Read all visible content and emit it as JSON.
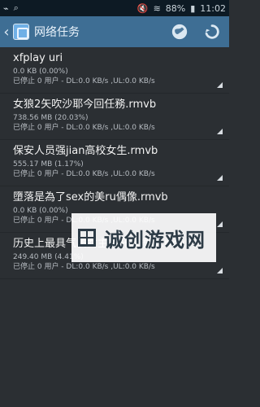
{
  "status_bar": {
    "left_icons": [
      "usb-icon",
      "search-icon"
    ],
    "right_icons": [
      "mute-icon",
      "wifi-icon",
      "battery-icon"
    ],
    "battery": "88%",
    "time": "11:02"
  },
  "app_bar": {
    "title": "网络任务",
    "actions": [
      "globe-icon",
      "refresh-icon"
    ]
  },
  "tasks": [
    {
      "name": "xfplay uri",
      "size": "0.0 KB (0.00%)",
      "status": "已停止 0 用户 - DL:0.0 KB/s ,UL:0.0 KB/s"
    },
    {
      "name": "女狼2矢吹沙耶今回任務.rmvb",
      "size": "738.56 MB (20.03%)",
      "status": "已停止 0 用户 - DL:0.0 KB/s ,UL:0.0 KB/s"
    },
    {
      "name": "保安人员强jian高校女生.rmvb",
      "size": "555.17 MB (1.17%)",
      "status": "已停止 0 用户 - DL:0.0 KB/s ,UL:0.0 KB/s"
    },
    {
      "name": "墮落是為了sex的美ru偶像.rmvb",
      "size": "0.0 KB (0.00%)",
      "status": "已停止 0 用户 - DL:0.0 KB/s ,UL:0.0 KB/s"
    },
    {
      "name": "历史上最具气质女主播开八摸佳.rmvb",
      "size": "249.40 MB (4.41%)",
      "status": "已停止 0 用户 - DL:0.0 KB/s ,UL:0.0 KB/s"
    }
  ],
  "watermark": {
    "text": "诚创游戏网"
  }
}
